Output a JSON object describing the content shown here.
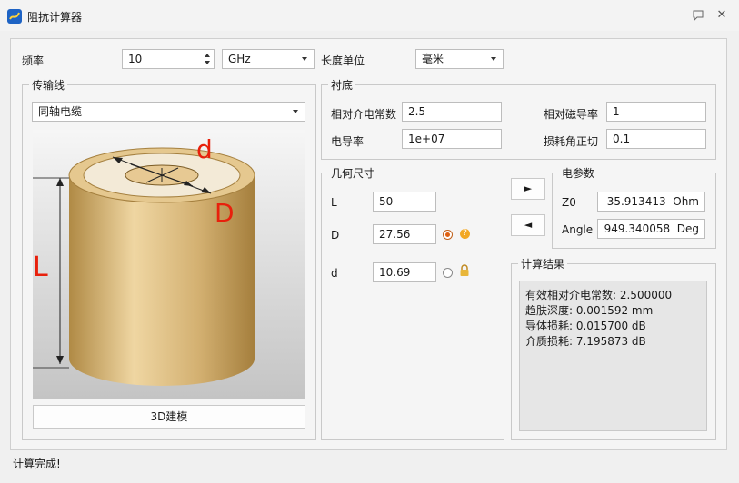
{
  "window": {
    "title": "阻抗计算器"
  },
  "top": {
    "freq_label": "频率",
    "freq_value": "10",
    "freq_unit": "GHz",
    "length_label": "长度单位",
    "length_unit": "毫米"
  },
  "tline": {
    "group_title": "传输线",
    "type_value": "同轴电缆",
    "model_button": "3D建模",
    "diagram_labels": {
      "L": "L",
      "D": "D",
      "d": "d"
    }
  },
  "substrate": {
    "group_title": "衬底",
    "er_label": "相对介电常数",
    "er_value": "2.5",
    "mur_label": "相对磁导率",
    "mur_value": "1",
    "sigma_label": "电导率",
    "sigma_value": "1e+07",
    "tand_label": "损耗角正切",
    "tand_value": "0.1"
  },
  "geometry": {
    "group_title": "几何尺寸",
    "L_label": "L",
    "L_value": "50",
    "D_label": "D",
    "D_value": "27.56",
    "d_label": "d",
    "d_value": "10.69"
  },
  "arrows": {
    "forward": "►",
    "back": "◄"
  },
  "electrical": {
    "group_title": "电参数",
    "z0_label": "Z0",
    "z0_value": "35.913413",
    "z0_unit": "Ohm",
    "angle_label": "Angle",
    "angle_value": "949.340058",
    "angle_unit": "Deg"
  },
  "results": {
    "group_title": "计算结果",
    "lines": [
      "有效相对介电常数: 2.500000",
      "趋肤深度: 0.001592 mm",
      "导体损耗: 0.015700 dB",
      "介质损耗: 7.195873 dB"
    ]
  },
  "status": {
    "text": "计算完成!"
  },
  "colors": {
    "accent": "#1e63c4",
    "label_red": "#e8200c",
    "radio_selected": "#e06010"
  },
  "icons": {
    "app": "app-icon",
    "help": "help-icon",
    "lock": "lock-icon",
    "comment": "comment-icon",
    "close": "close-icon"
  }
}
